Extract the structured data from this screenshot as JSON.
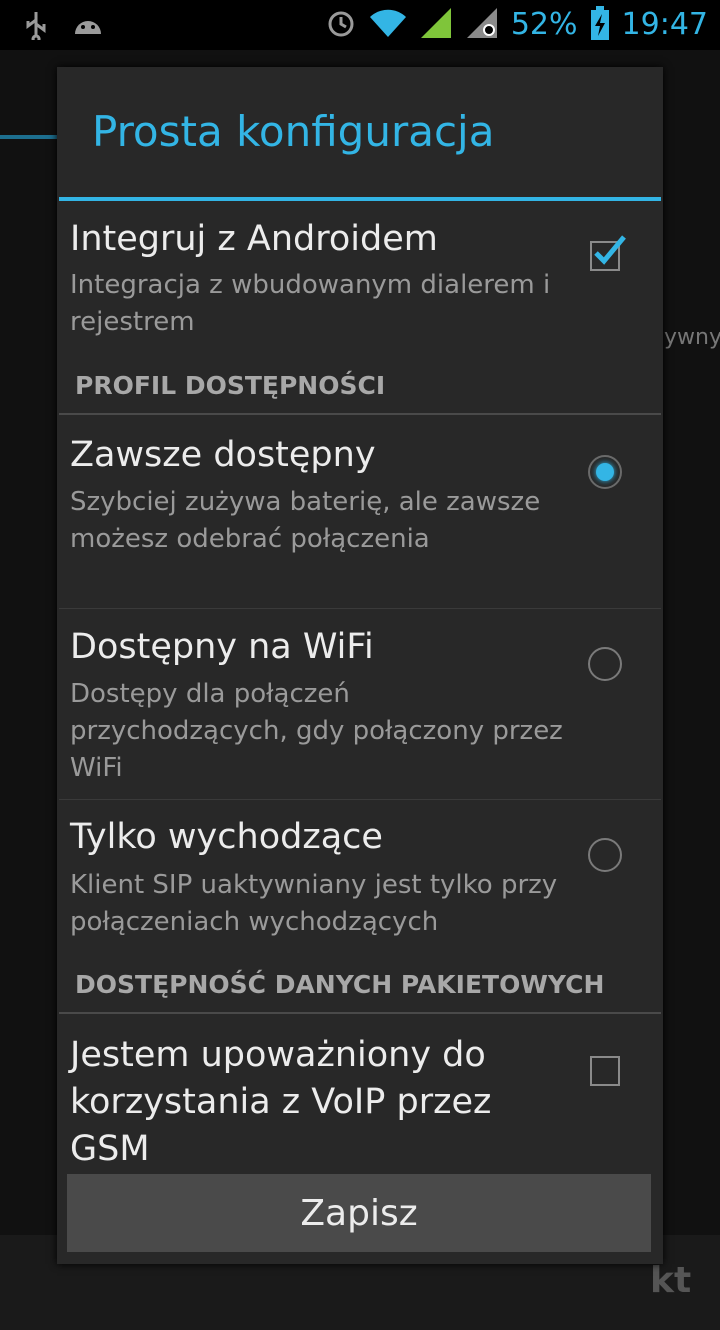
{
  "status_bar": {
    "battery": "52%",
    "time": "19:47",
    "icons": [
      "usb-icon",
      "android-debug-icon",
      "alarm-icon",
      "wifi-icon",
      "signal-icon",
      "roaming-signal-icon",
      "battery-charging-icon"
    ]
  },
  "background": {
    "right_fragment": "ywny",
    "bottom_fragment": "kt"
  },
  "dialog": {
    "title": "Prosta konfiguracja",
    "integrate": {
      "title": "Integruj z Androidem",
      "summary": "Integracja z wbudowanym dialerem i rejestrem",
      "checked": true
    },
    "section_profile": "PROFIL DOSTĘPNOŚCI",
    "options": [
      {
        "title": "Zawsze dostępny",
        "summary": "Szybciej zużywa baterię, ale zawsze możesz odebrać połączenia",
        "selected": true
      },
      {
        "title": "Dostępny na WiFi",
        "summary": "Dostępy dla połączeń przychodzących, gdy połączony przez WiFi",
        "selected": false
      },
      {
        "title": "Tylko wychodzące",
        "summary": "Klient SIP uaktywniany jest tylko przy połączeniach wychodzących",
        "selected": false
      }
    ],
    "section_data": "DOSTĘPNOŚĆ DANYCH PAKIETOWYCH",
    "voip_gsm": {
      "title": "Jestem upoważniony do korzystania z VoIP przez GSM",
      "checked": false
    },
    "save_label": "Zapisz"
  },
  "colors": {
    "accent": "#33b5e5",
    "dialog_bg": "#282828",
    "text": "#ececec",
    "summary": "#9a9a9a"
  }
}
